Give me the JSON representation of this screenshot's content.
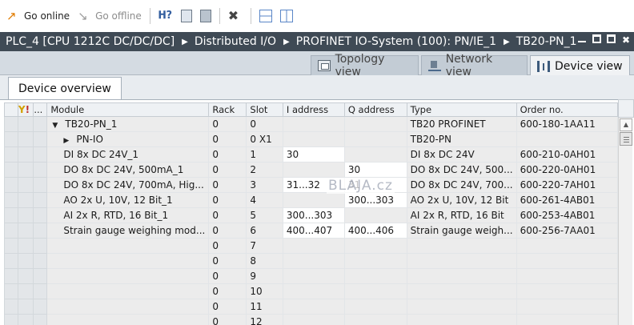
{
  "toolbar": {
    "go_online": "Go online",
    "go_offline": "Go offline"
  },
  "breadcrumb": [
    "PLC_4 [CPU 1212C DC/DC/DC]",
    "Distributed I/O",
    "PROFINET IO-System (100): PN/IE_1",
    "TB20-PN_1"
  ],
  "view_tabs": {
    "topology": "Topology view",
    "network": "Network view",
    "device": "Device view"
  },
  "overview_tab": "Device overview",
  "table": {
    "columns": [
      "...",
      "Module",
      "Rack",
      "Slot",
      "I address",
      "Q address",
      "Type",
      "Order no."
    ],
    "rows": [
      {
        "module": "TB20-PN_1",
        "rack": "0",
        "slot": "0",
        "i": "",
        "q": "",
        "type": "TB20 PROFINET",
        "order": "600-180-1AA11"
      },
      {
        "module": "PN-IO",
        "rack": "0",
        "slot": "0 X1",
        "i": "",
        "q": "",
        "type": "TB20-PN",
        "order": ""
      },
      {
        "module": "DI 8x DC 24V_1",
        "rack": "0",
        "slot": "1",
        "i": "30",
        "q": "",
        "type": "DI 8x DC 24V",
        "order": "600-210-0AH01"
      },
      {
        "module": "DO 8x DC 24V, 500mA_1",
        "rack": "0",
        "slot": "2",
        "i": "",
        "q": "30",
        "type": "DO 8x DC 24V, 500...",
        "order": "600-220-0AH01"
      },
      {
        "module": "DO 8x DC 24V, 700mA, Hig...",
        "rack": "0",
        "slot": "3",
        "i": "31...32",
        "q": "31",
        "type": "DO 8x DC 24V, 700...",
        "order": "600-220-7AH01"
      },
      {
        "module": "AO 2x U, 10V, 12 Bit_1",
        "rack": "0",
        "slot": "4",
        "i": "",
        "q": "300...303",
        "type": "AO 2x U, 10V, 12 Bit",
        "order": "600-261-4AB01"
      },
      {
        "module": "AI 2x R, RTD, 16 Bit_1",
        "rack": "0",
        "slot": "5",
        "i": "300...303",
        "q": "",
        "type": "AI 2x R, RTD, 16 Bit",
        "order": "600-253-4AB01"
      },
      {
        "module": "Strain gauge weighing mod...",
        "rack": "0",
        "slot": "6",
        "i": "400...407",
        "q": "400...406",
        "type": "Strain gauge weigh...",
        "order": "600-256-7AA01"
      },
      {
        "module": "",
        "rack": "0",
        "slot": "7",
        "i": "",
        "q": "",
        "type": "",
        "order": ""
      },
      {
        "module": "",
        "rack": "0",
        "slot": "8",
        "i": "",
        "q": "",
        "type": "",
        "order": ""
      },
      {
        "module": "",
        "rack": "0",
        "slot": "9",
        "i": "",
        "q": "",
        "type": "",
        "order": ""
      },
      {
        "module": "",
        "rack": "0",
        "slot": "10",
        "i": "",
        "q": "",
        "type": "",
        "order": ""
      },
      {
        "module": "",
        "rack": "0",
        "slot": "11",
        "i": "",
        "q": "",
        "type": "",
        "order": ""
      },
      {
        "module": "",
        "rack": "0",
        "slot": "12",
        "i": "",
        "q": "",
        "type": "",
        "order": ""
      }
    ]
  },
  "watermark": "BLAJA.cz"
}
